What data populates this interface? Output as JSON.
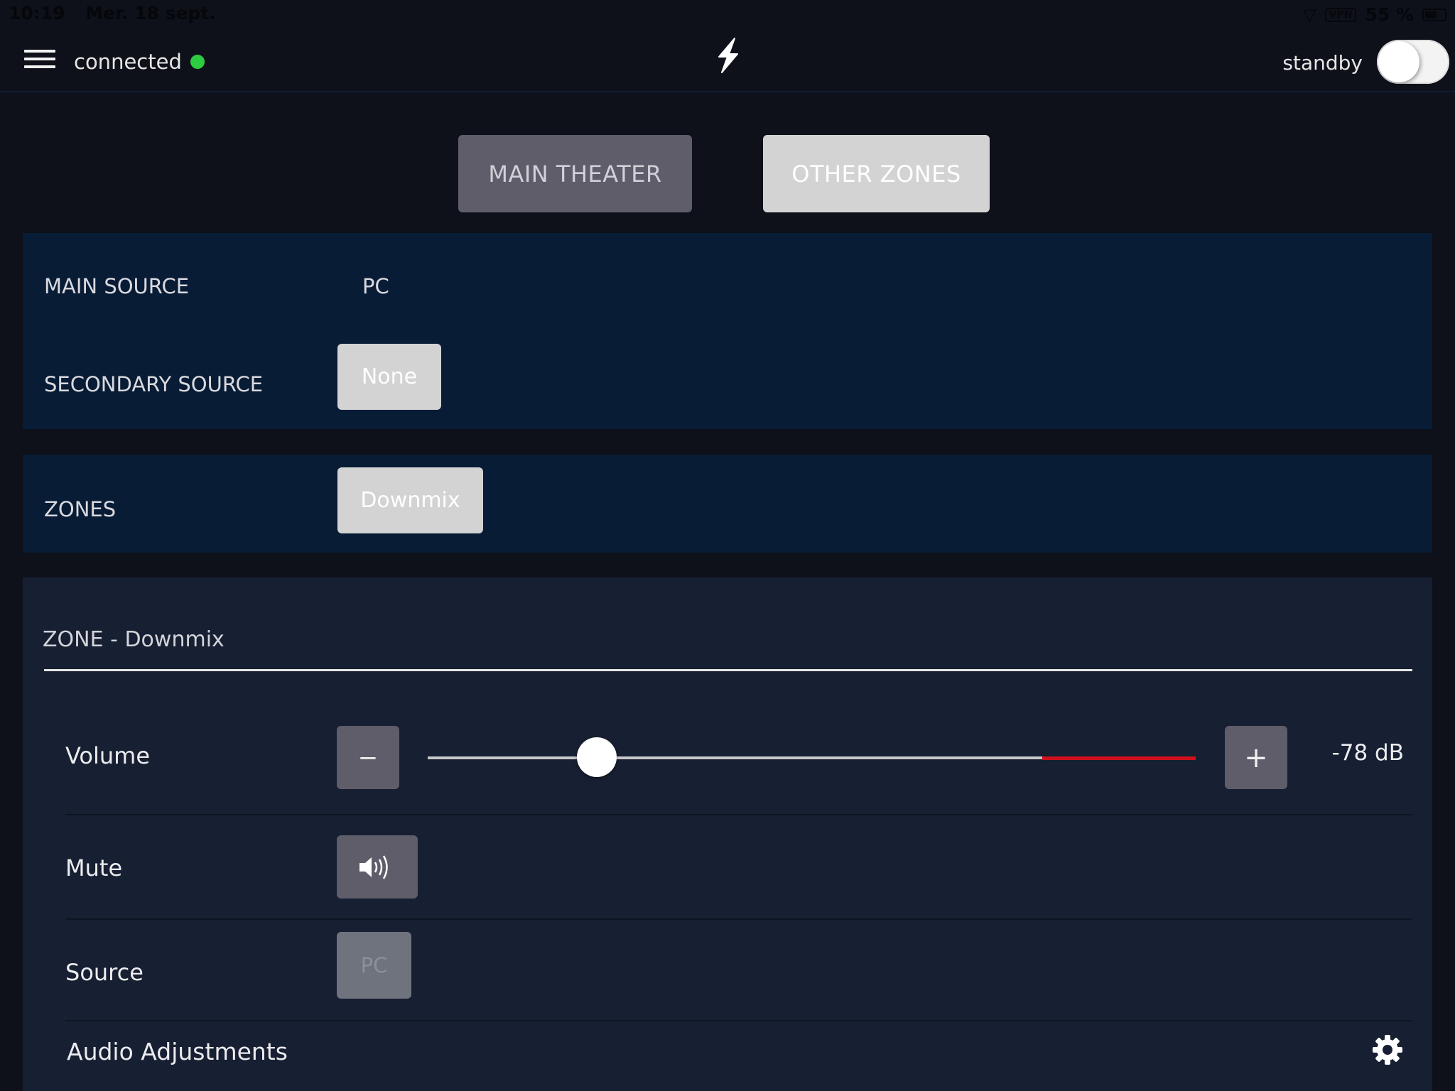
{
  "status_bar": {
    "time": "10:19",
    "date": "Mer. 18 sept.",
    "vpn_label": "VPN",
    "battery": "55 %"
  },
  "header": {
    "connection_status": "connected",
    "connection_color": "#2ecc40",
    "standby_label": "standby",
    "standby_on": false,
    "logo_icon": "lightning-bolt-icon"
  },
  "tabs": [
    {
      "label": "MAIN THEATER",
      "active": false
    },
    {
      "label": "OTHER ZONES",
      "active": true
    }
  ],
  "sources": {
    "main_source_label": "MAIN SOURCE",
    "main_source_value": "PC",
    "secondary_source_label": "SECONDARY SOURCE",
    "secondary_source_value": "None"
  },
  "zones": {
    "label": "ZONES",
    "selected": "Downmix"
  },
  "zone_panel": {
    "title": "ZONE - Downmix",
    "volume": {
      "label": "Volume",
      "minus": "−",
      "plus": "+",
      "value_text": "-78 dB",
      "slider_fraction": 0.22,
      "red_zone_start_fraction": 0.8,
      "red_color": "#d0101c"
    },
    "mute": {
      "label": "Mute",
      "icon": "speaker-volume-icon"
    },
    "source": {
      "label": "Source",
      "value": "PC",
      "disabled": true
    },
    "audio_adjustments": {
      "label": "Audio Adjustments",
      "icon": "gear-icon"
    }
  }
}
